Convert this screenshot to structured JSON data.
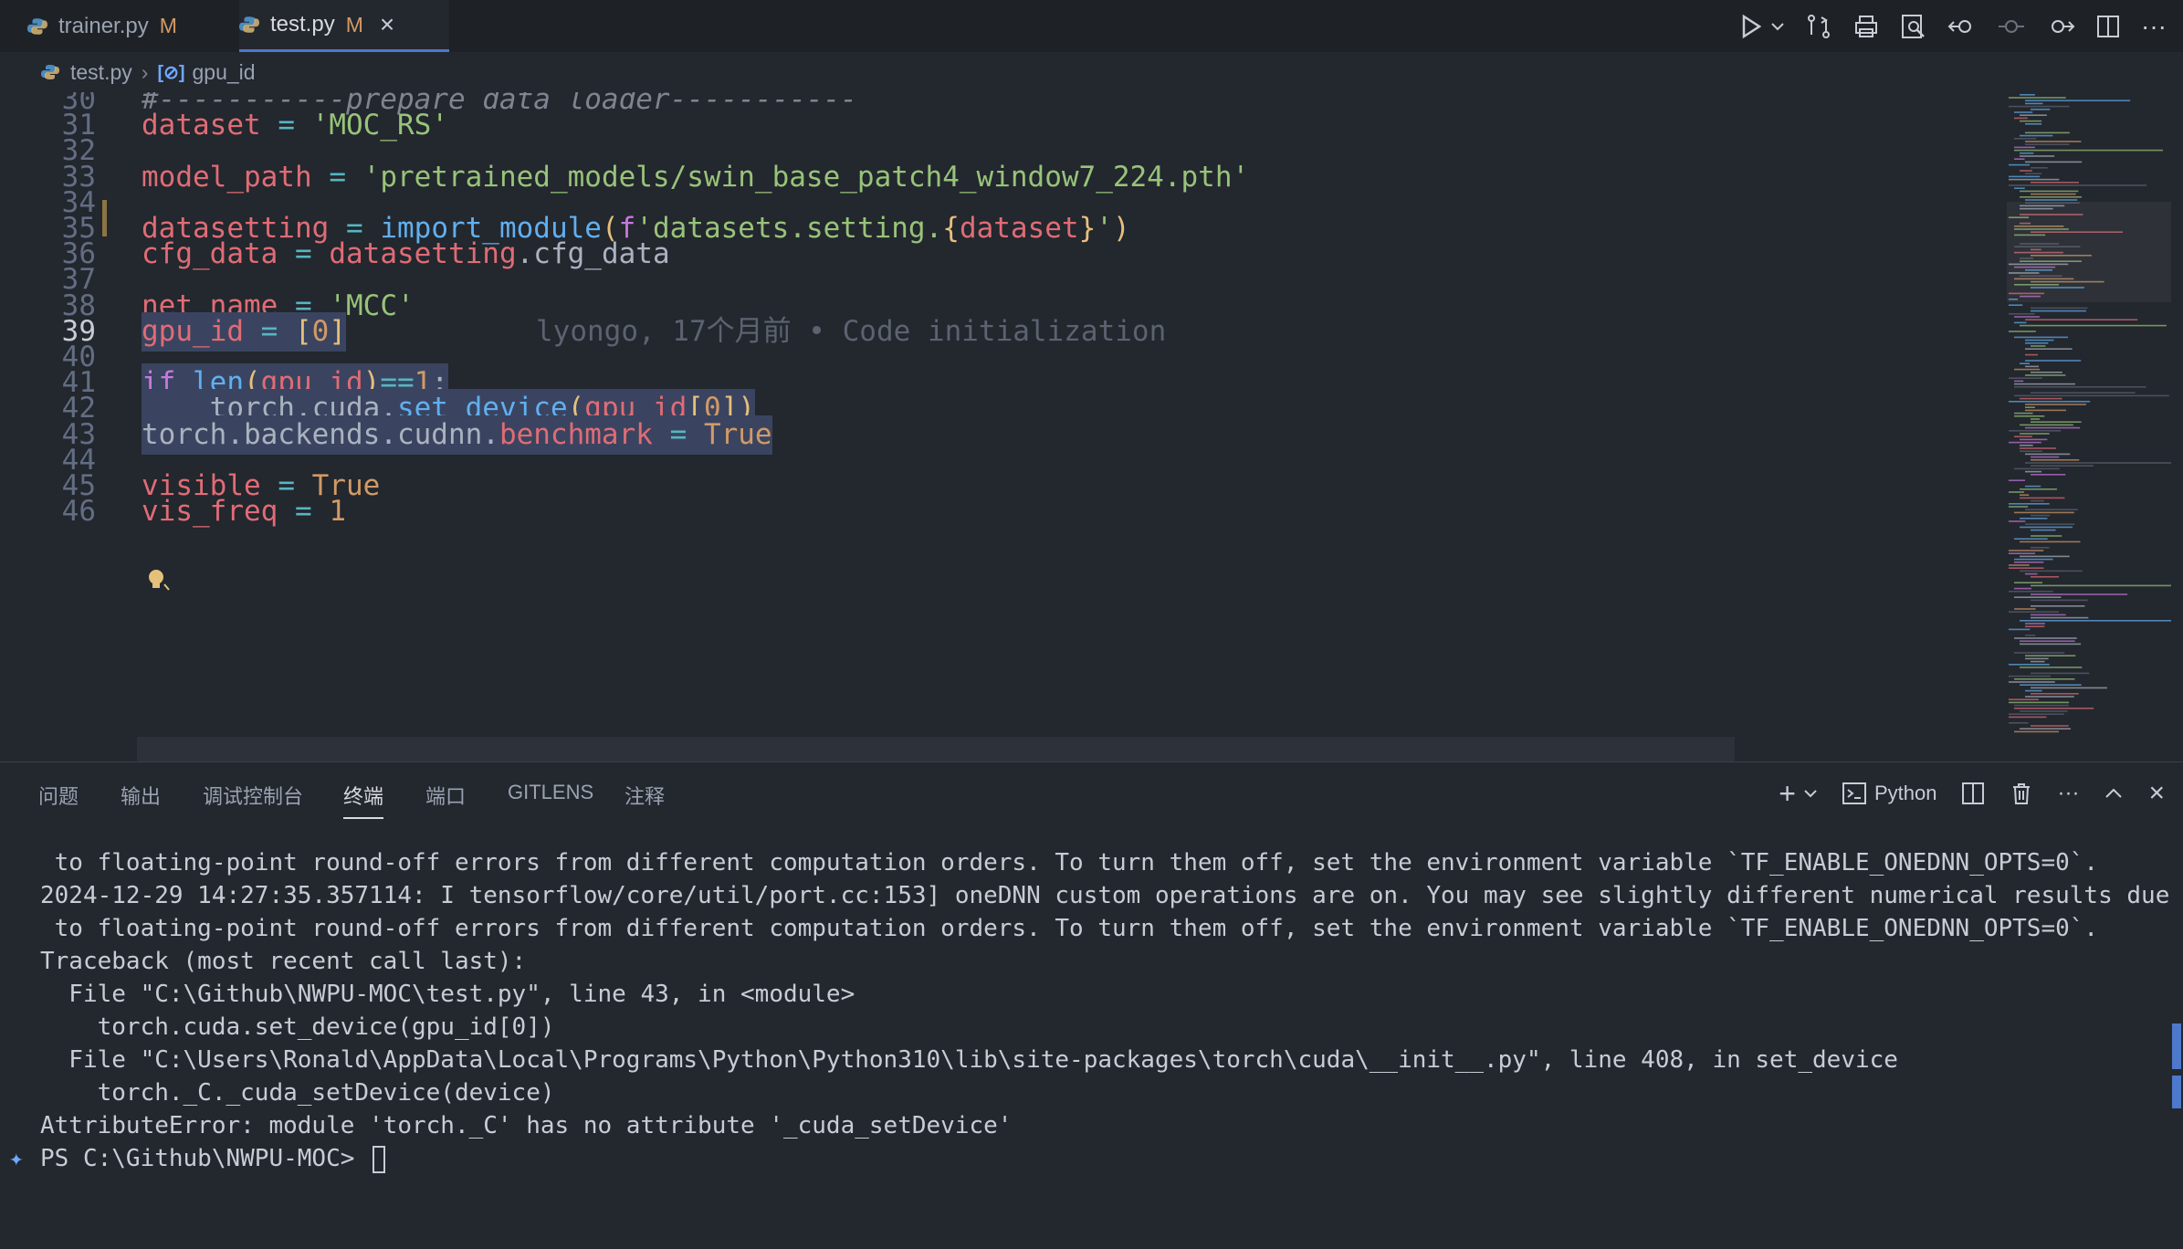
{
  "tabs": [
    {
      "name": "trainer.py",
      "modified": "M"
    },
    {
      "name": "test.py",
      "modified": "M"
    }
  ],
  "breadcrumb": {
    "file": "test.py",
    "symbol": "gpu_id"
  },
  "editor": {
    "lines": [
      {
        "n": "30",
        "tokens": [
          [
            "cmt",
            "#-----------prepare data loader-----------"
          ]
        ]
      },
      {
        "n": "31",
        "tokens": [
          [
            "var",
            "dataset"
          ],
          [
            "plain",
            " "
          ],
          [
            "op",
            "="
          ],
          [
            "plain",
            " "
          ],
          [
            "str",
            "'MOC_RS'"
          ]
        ]
      },
      {
        "n": "32",
        "tokens": []
      },
      {
        "n": "33",
        "tokens": [
          [
            "var",
            "model_path"
          ],
          [
            "plain",
            " "
          ],
          [
            "op",
            "="
          ],
          [
            "plain",
            " "
          ],
          [
            "str",
            "'pretrained_models/swin_base_patch4_window7_224.pth'"
          ]
        ]
      },
      {
        "n": "34",
        "tokens": []
      },
      {
        "n": "35",
        "tokens": [
          [
            "var",
            "datasetting"
          ],
          [
            "plain",
            " "
          ],
          [
            "op",
            "="
          ],
          [
            "plain",
            " "
          ],
          [
            "fn",
            "import_module"
          ],
          [
            "br",
            "("
          ],
          [
            "kw",
            "f"
          ],
          [
            "str",
            "'datasets.setting."
          ],
          [
            "br",
            "{"
          ],
          [
            "var",
            "dataset"
          ],
          [
            "br",
            "}"
          ],
          [
            "str",
            "'"
          ],
          [
            "br",
            ")"
          ]
        ]
      },
      {
        "n": "36",
        "tokens": [
          [
            "var",
            "cfg_data"
          ],
          [
            "plain",
            " "
          ],
          [
            "op",
            "="
          ],
          [
            "plain",
            " "
          ],
          [
            "var",
            "datasetting"
          ],
          [
            "plain",
            ".cfg_data"
          ]
        ]
      },
      {
        "n": "37",
        "tokens": []
      },
      {
        "n": "38",
        "tokens": [
          [
            "var",
            "net_name"
          ],
          [
            "plain",
            " "
          ],
          [
            "op",
            "="
          ],
          [
            "plain",
            " "
          ],
          [
            "str",
            "'MCC'"
          ]
        ]
      },
      {
        "n": "39",
        "tokens": [
          [
            "var",
            "gpu_id"
          ],
          [
            "plain",
            " "
          ],
          [
            "op",
            "="
          ],
          [
            "plain",
            " "
          ],
          [
            "br",
            "["
          ],
          [
            "num",
            "0"
          ],
          [
            "br",
            "]"
          ]
        ]
      },
      {
        "n": "40",
        "tokens": []
      },
      {
        "n": "41",
        "tokens": [
          [
            "kw",
            "if"
          ],
          [
            "plain",
            " "
          ],
          [
            "fn",
            "len"
          ],
          [
            "br",
            "("
          ],
          [
            "var",
            "gpu_id"
          ],
          [
            "br",
            ")"
          ],
          [
            "op",
            "=="
          ],
          [
            "num",
            "1"
          ],
          [
            "plain",
            ":"
          ]
        ]
      },
      {
        "n": "42",
        "tokens": [
          [
            "plain",
            "    torch.cuda."
          ],
          [
            "fn",
            "set_device"
          ],
          [
            "br",
            "("
          ],
          [
            "var",
            "gpu_id"
          ],
          [
            "br",
            "["
          ],
          [
            "num",
            "0"
          ],
          [
            "br",
            "]"
          ],
          [
            "br",
            ")"
          ]
        ]
      },
      {
        "n": "43",
        "tokens": [
          [
            "plain",
            "torch.backends.cudnn."
          ],
          [
            "var",
            "benchmark"
          ],
          [
            "plain",
            " "
          ],
          [
            "op",
            "="
          ],
          [
            "plain",
            " "
          ],
          [
            "num",
            "True"
          ]
        ]
      },
      {
        "n": "44",
        "tokens": []
      },
      {
        "n": "45",
        "tokens": [
          [
            "var",
            "visible"
          ],
          [
            "plain",
            " "
          ],
          [
            "op",
            "="
          ],
          [
            "plain",
            " "
          ],
          [
            "num",
            "True"
          ]
        ]
      },
      {
        "n": "46",
        "tokens": [
          [
            "var",
            "vis_freq"
          ],
          [
            "plain",
            " "
          ],
          [
            "op",
            "="
          ],
          [
            "plain",
            " "
          ],
          [
            "num",
            "1"
          ]
        ]
      }
    ],
    "current_line": "39",
    "blame": "lyongo, 17个月前 • Code initialization"
  },
  "panel": {
    "tabs": [
      "问题",
      "输出",
      "调试控制台",
      "终端",
      "端口",
      "GITLENS",
      "注释"
    ],
    "active_tab": "终端",
    "shell": "Python"
  },
  "terminal": {
    "lines": [
      " to floating-point round-off errors from different computation orders. To turn them off, set the environment variable `TF_ENABLE_ONEDNN_OPTS=0`.",
      "2024-12-29 14:27:35.357114: I tensorflow/core/util/port.cc:153] oneDNN custom operations are on. You may see slightly different numerical results due",
      " to floating-point round-off errors from different computation orders. To turn them off, set the environment variable `TF_ENABLE_ONEDNN_OPTS=0`.",
      "Traceback (most recent call last):",
      "  File \"C:\\Github\\NWPU-MOC\\test.py\", line 43, in <module>",
      "    torch.cuda.set_device(gpu_id[0])",
      "  File \"C:\\Users\\Ronald\\AppData\\Local\\Programs\\Python\\Python310\\lib\\site-packages\\torch\\cuda\\__init__.py\", line 408, in set_device",
      "    torch._C._cuda_setDevice(device)",
      "AttributeError: module 'torch._C' has no attribute '_cuda_setDevice'"
    ],
    "prompt": "PS C:\\Github\\NWPU-MOC> "
  }
}
